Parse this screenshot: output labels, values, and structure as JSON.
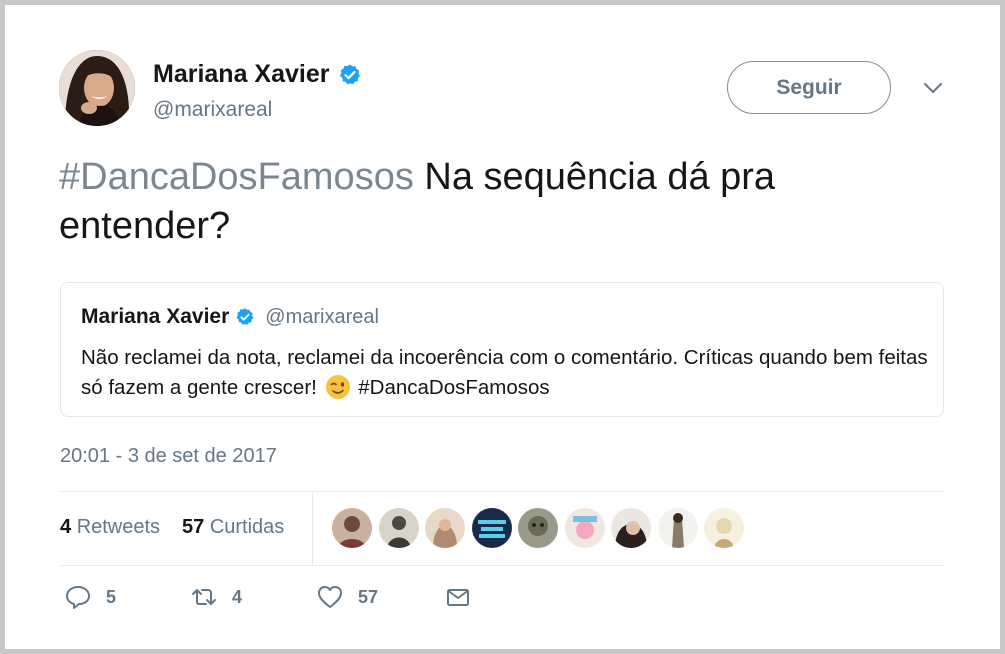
{
  "author": {
    "name": "Mariana Xavier",
    "handle": "@marixareal",
    "verified_color": "#1da1f2",
    "avatar_icon": "profile-photo"
  },
  "follow_label": "Seguir",
  "tweet": {
    "hashtag": "#DancaDosFamosos",
    "text": " Na sequência dá pra entender?"
  },
  "quoted_tweet": {
    "name": "Mariana Xavier",
    "handle": "@marixareal",
    "text_before": "Não reclamei da nota, reclamei da incoerência com o comentário. Críticas quando bem feitas só fazem a gente crescer! ",
    "emoji": "winking-face",
    "hashtag": " #DancaDosFamosos"
  },
  "timestamp": "20:01 - 3 de set de 2017",
  "stats": {
    "retweets_count": "4",
    "retweets_label": "Retweets",
    "likes_count": "57",
    "likes_label": "Curtidas"
  },
  "likers": [
    {
      "icon": "liker-avatar-1",
      "color": "#6b4a3e"
    },
    {
      "icon": "liker-avatar-2",
      "color": "#4a4a40"
    },
    {
      "icon": "liker-avatar-3",
      "color": "#b08a70"
    },
    {
      "icon": "liker-avatar-4",
      "color": "#1a2a4a"
    },
    {
      "icon": "liker-avatar-5",
      "color": "#6a6a5a"
    },
    {
      "icon": "liker-avatar-6",
      "color": "#d8c8b8"
    },
    {
      "icon": "liker-avatar-7",
      "color": "#2a2020"
    },
    {
      "icon": "liker-avatar-8",
      "color": "#8a7a6a"
    },
    {
      "icon": "liker-avatar-9",
      "color": "#e8d8b0"
    }
  ],
  "actions": {
    "reply_count": "5",
    "retweet_count": "4",
    "like_count": "57"
  },
  "colors": {
    "text_secondary": "#657786",
    "hashtag_main": "#7b8790",
    "border": "#e1e8ed"
  }
}
